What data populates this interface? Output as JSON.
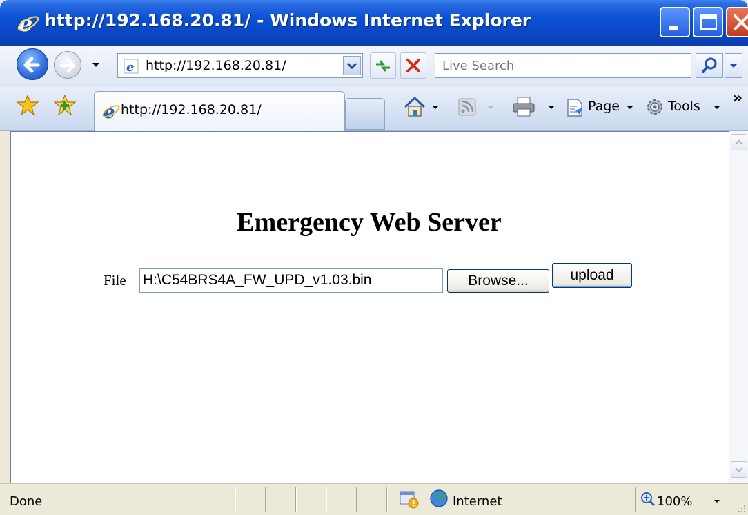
{
  "window": {
    "title": "http://192.168.20.81/ - Windows Internet Explorer"
  },
  "navbar": {
    "address": "http://192.168.20.81/",
    "search_placeholder": "Live Search"
  },
  "tabs": [
    {
      "label": "http://192.168.20.81/"
    }
  ],
  "commands": {
    "page_label": "Page",
    "tools_label": "Tools"
  },
  "page": {
    "heading": "Emergency Web Server",
    "file_label": "File",
    "file_value": "H:\\C54BRS4A_FW_UPD_v1.03.bin",
    "browse_label": "Browse...",
    "upload_label": "upload"
  },
  "statusbar": {
    "status": "Done",
    "zone": "Internet",
    "zoom": "100%"
  },
  "colors": {
    "titlebar": "#0b51d4",
    "close_button": "#c53a1e",
    "chrome": "#ece9d8",
    "toolbar": "#dde7f4"
  }
}
